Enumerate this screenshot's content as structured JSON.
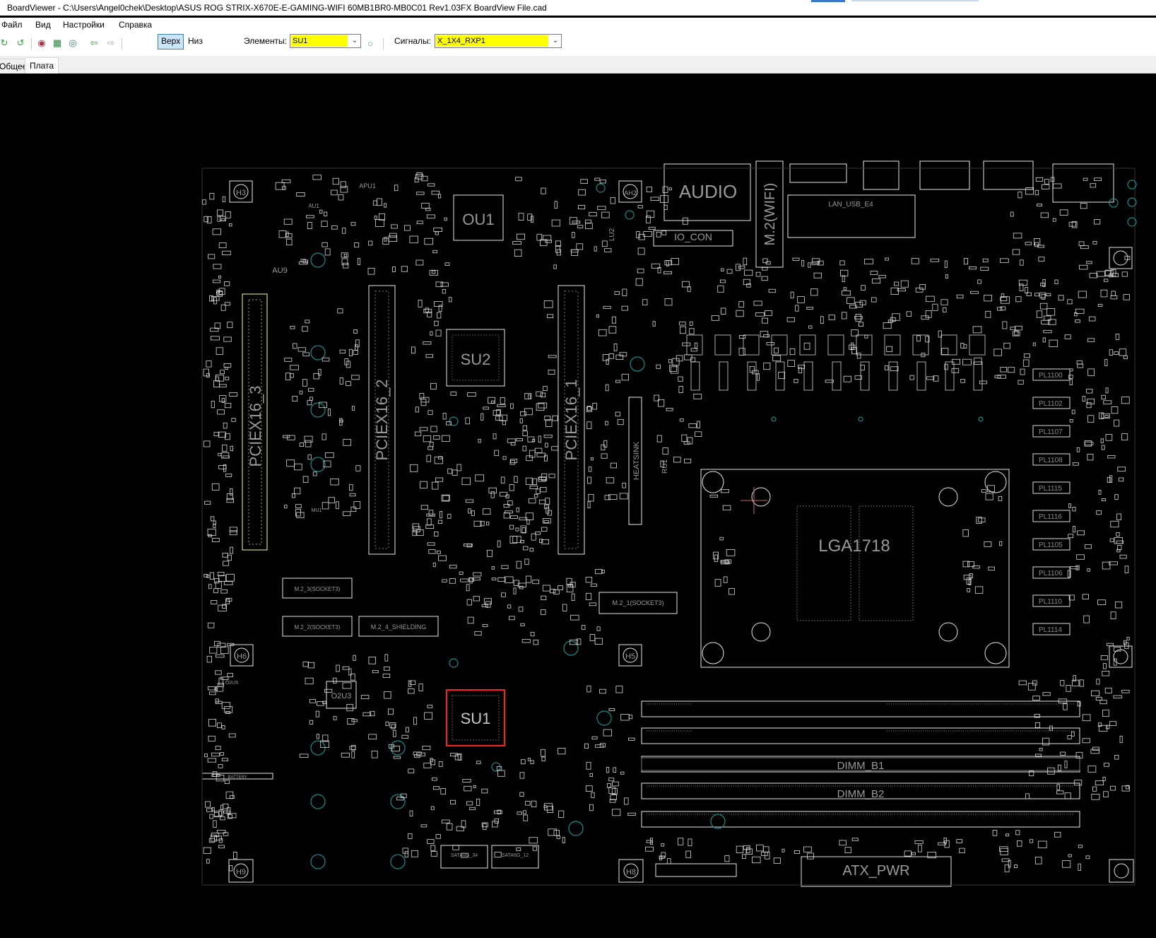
{
  "window": {
    "title": "BoardViewer  -  C:\\Users\\Angel0chek\\Desktop\\ASUS ROG STRIX-X670E-E-GAMING-WIFI 60MB1BR0-MB0C01 Rev1.03FX BoardView File.cad"
  },
  "menu": {
    "file": "Файл",
    "view": "Вид",
    "settings": "Настройки",
    "help": "Справка"
  },
  "toolbar": {
    "top_label": "Верх",
    "bottom_label": "Низ",
    "elements_label": "Элементы:",
    "elements_value": "SU1",
    "signals_label": "Сигналы:",
    "signals_value": "X_1X4_RXP1",
    "icons": [
      "rotate-left-icon",
      "rotate-right-icon",
      "zoom-in-icon",
      "zoom-fit-icon",
      "zoom-out-icon",
      "back-arrow-icon",
      "forward-arrow-icon",
      "bulb-icon"
    ]
  },
  "tabs": {
    "general": "Общее",
    "board": "Плата",
    "active": "board"
  },
  "board": {
    "colors": {
      "outline": "#e8e8e8",
      "highlight": "#ff2020",
      "selected_net": "#ffff80",
      "via": "#1a8c8c",
      "text": "#9a9a9a"
    },
    "labels": {
      "cpu_socket": "LGA1718",
      "su2": "SU2",
      "su1": "SU1",
      "ou1": "OU1",
      "o2u3": "O2U3",
      "pcie_3": "PCIEX16_3",
      "pcie_2": "PCIEX16_2",
      "pcie_1": "PCIEX16_1",
      "audio": "AUDIO",
      "m2_wifi": "M.2(WIFI)",
      "io_con": "IO_CON",
      "usb_e4": "LAN_USB_E4",
      "dimm_b1": "DIMM_B1",
      "dimm_b2": "DIMM_B2",
      "atx_pwr": "ATX_PWR",
      "m2_3": "M.2_3(SOCKET3)",
      "m2_2": "M.2_2(SOCKET3)",
      "m2_4": "M.2_4_SHIELDING",
      "m2_1": "M.2_1(SOCKET3)",
      "battery": "BATTERY",
      "heatsink": "HEATSINK",
      "sata_34": "SATA6G_34",
      "sata_12": "SATA6G_12",
      "h3": "H3",
      "h5": "H5",
      "h6": "H6",
      "h8": "H8",
      "h9": "H9",
      "ah2": "AH2",
      "apu1": "APU1",
      "au9": "AU9",
      "au1": "AU1",
      "mu1": "MU1",
      "lu2": "LU2",
      "ru1": "RU1",
      "o2u5": "O2U5",
      "pl_labels": [
        "PL1100",
        "PL1102",
        "PL1107",
        "PL1108",
        "PL1115",
        "PL1116",
        "PL1105",
        "PL1106",
        "PL1110",
        "PL1114"
      ]
    }
  }
}
